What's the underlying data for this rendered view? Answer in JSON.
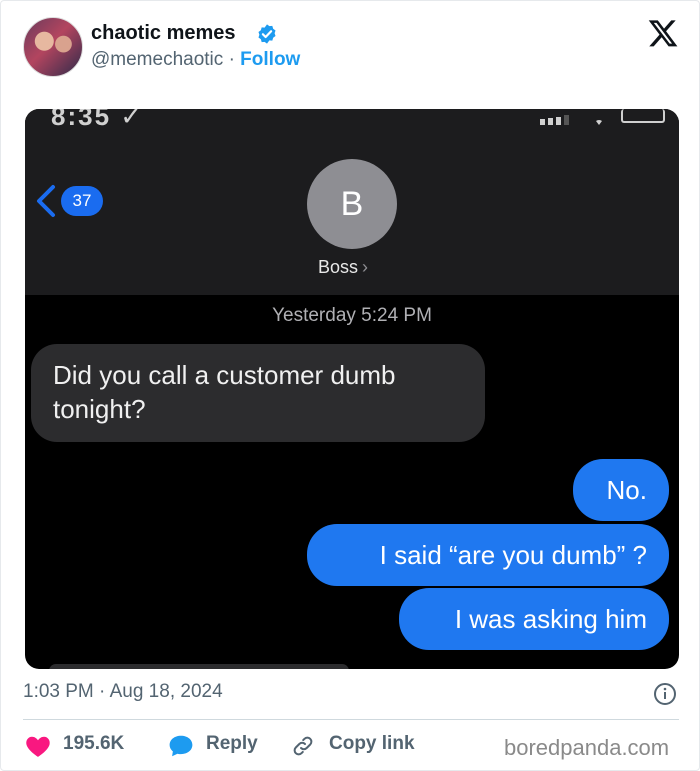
{
  "tweet": {
    "display_name": "chaotic memes",
    "handle": "@memechaotic",
    "separator": "·",
    "follow_label": "Follow",
    "date_meta": "1:03 PM · Aug 18, 2024",
    "likes_count": "195.6K",
    "reply_label": "Reply",
    "copy_link_label": "Copy link",
    "watermark": "boredpanda.com"
  },
  "screenshot": {
    "status_time": "8:35 ✓",
    "back_count": "37",
    "contact_initial": "B",
    "contact_name": "Boss",
    "chevron_right": "›",
    "timestamp": "Yesterday 5:24 PM",
    "messages_in": [
      "Did you call a customer dumb tonight?"
    ],
    "messages_out": [
      "No.",
      "I said “are you dumb” ?",
      "I was asking him"
    ]
  },
  "colors": {
    "follow_blue": "#1d9bf0",
    "like_pink": "#f91880",
    "imessage_blue": "#1f78f0",
    "incoming_gray": "#2c2c2e"
  },
  "icons": [
    "verified-badge-icon",
    "x-logo-icon",
    "info-icon",
    "heart-icon",
    "reply-bubble-icon",
    "link-icon",
    "back-chevron-icon"
  ]
}
